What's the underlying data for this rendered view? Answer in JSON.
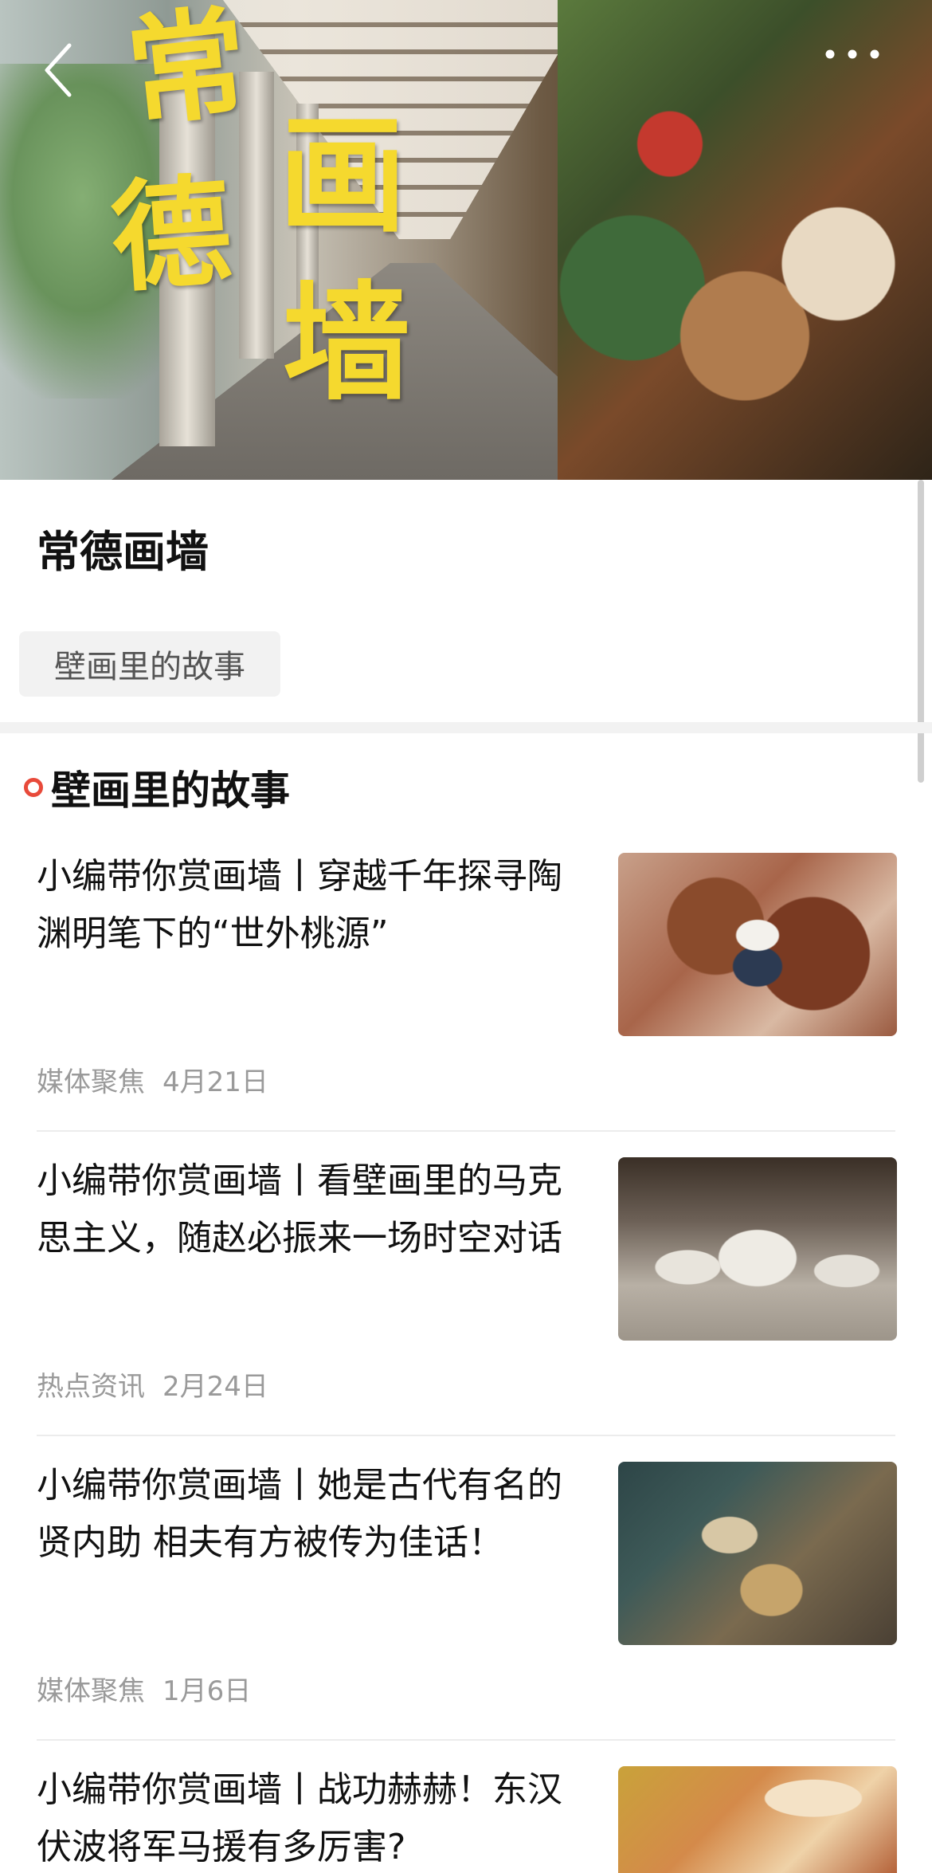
{
  "hero": {
    "title_chars": [
      "常",
      "德",
      "画",
      "墙"
    ]
  },
  "page": {
    "title": "常德画墙"
  },
  "tags": [
    {
      "label": "壁画里的故事"
    }
  ],
  "section": {
    "title": "壁画里的故事"
  },
  "articles": [
    {
      "title": "小编带你赏画墙丨穿越千年探寻陶渊明笔下的“世外桃源”",
      "source": "媒体聚焦",
      "date": "4月21日"
    },
    {
      "title": "小编带你赏画墙丨看壁画里的马克思主义，随赵必振来一场时空对话",
      "source": "热点资讯",
      "date": "2月24日"
    },
    {
      "title": "小编带你赏画墙丨她是古代有名的贤内助 相夫有方被传为佳话！",
      "source": "媒体聚焦",
      "date": "1月6日"
    },
    {
      "title": "小编带你赏画墙丨战功赫赫！东汉伏波将军马援有多厉害?",
      "source": "",
      "date": ""
    }
  ],
  "colors": {
    "accent": "#e84a3a",
    "title_yellow": "#f5d92e",
    "meta_gray": "#9a9a9a"
  },
  "icons": {
    "back": "chevron-left-icon",
    "more": "more-dots-icon",
    "section_marker": "circle-dot-icon"
  }
}
